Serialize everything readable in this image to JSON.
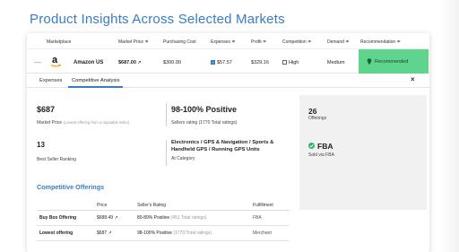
{
  "page": {
    "title": "Product Insights Across Selected Markets"
  },
  "columns": {
    "marketplace": "Marketplace",
    "market_price": "Market Price ≑",
    "purchasing_cost": "Purchasing Cost",
    "expenses": "Expenses ≑",
    "profit": "Profit ≑",
    "competition": "Competition ≑",
    "demand": "Demand ≑",
    "recommendation": "Recommendation ≑"
  },
  "row": {
    "collapse_symbol": "—",
    "marketplace": "Amazon US",
    "market_price": "$687.00",
    "purchasing_cost": "$300.00",
    "expenses": "$57.57",
    "profit": "$329.16",
    "competition": "High",
    "demand": "Medium",
    "recommendation": "Recommended",
    "recommend_color": "#5fd48d"
  },
  "tabs": [
    {
      "label": "Expenses",
      "active": false
    },
    {
      "label": "Competitive Analysis",
      "active": true
    }
  ],
  "close_symbol": "×",
  "metrics": {
    "market_price": {
      "value": "$687",
      "label": "Market Price",
      "note": "(Lowest offering from a reputable seller)"
    },
    "seller_rating": {
      "value": "98-100% Positive",
      "label": "Sellers rating (1770 Total ratings)"
    },
    "offerings": {
      "value": "26",
      "label": "Offerings"
    },
    "rank": {
      "value": "13",
      "label": "Best Seller Ranking"
    },
    "category": {
      "value_line1": "Electronics / GPS & Navigation / Sports &",
      "value_line2": "Handheld GPS / Running GPS Units",
      "label": "At Category"
    },
    "fulfillment": {
      "value": "FBA",
      "label": "Sold via FBA"
    }
  },
  "offerings_section": {
    "title": "Competitive Offerings",
    "headers": [
      "",
      "Price",
      "Seller's Rating",
      "Fulfillment"
    ],
    "rows": [
      {
        "label": "Buy Box Offering",
        "price": "$688.49",
        "rating": "80-89% Positive",
        "rating_count": "(451 Total ratings)",
        "fulfillment": "FBA"
      },
      {
        "label": "Lowest offering",
        "price": "$687",
        "rating": "98-100% Positive",
        "rating_count": "(1770 Total ratings)",
        "fulfillment": "Merchant"
      }
    ]
  },
  "colors": {
    "accent": "#3a7cc0",
    "success": "#2fb36a",
    "amazon_orange": "#f90"
  }
}
